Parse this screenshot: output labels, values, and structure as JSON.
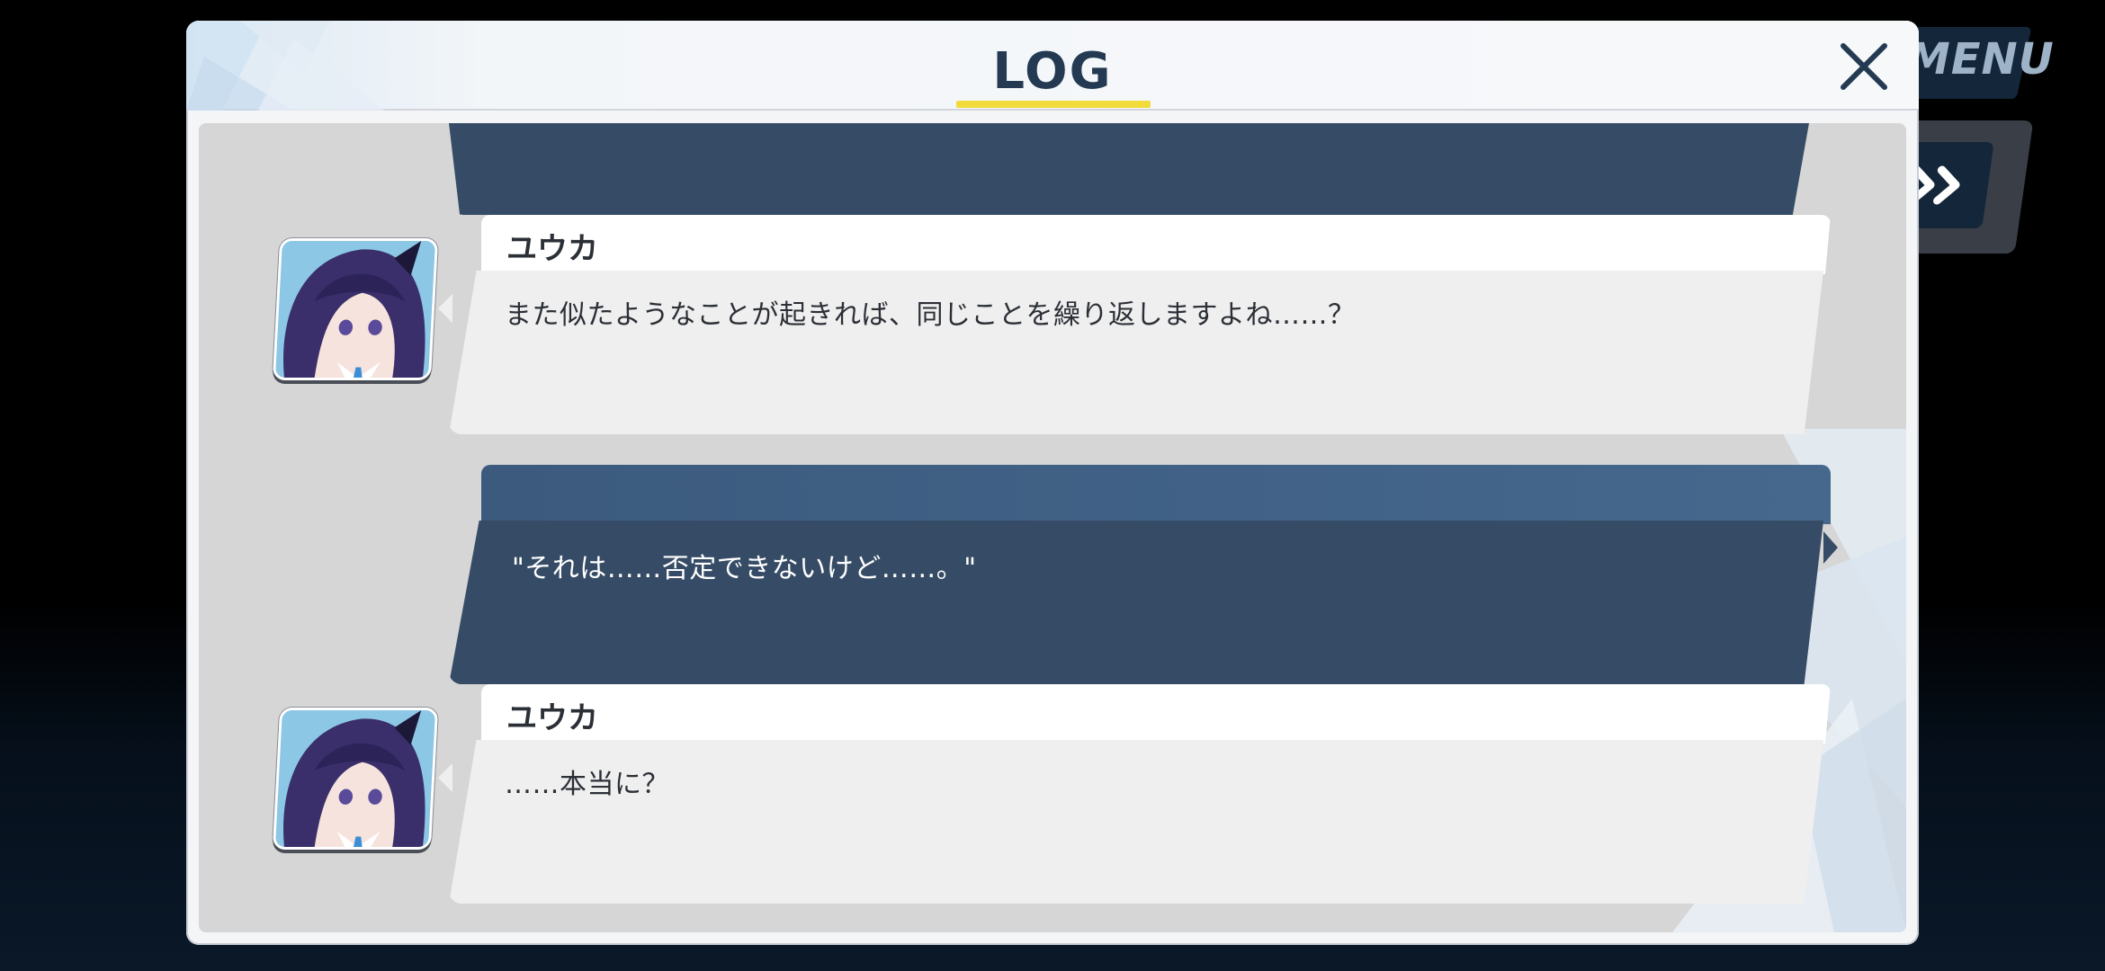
{
  "hud": {
    "menu_label": "MENU",
    "fast_forward_icon": "fast-forward-icon"
  },
  "log": {
    "title": "LOG",
    "close_icon": "close-icon",
    "accent_color": "#f1dc3c",
    "entries": [
      {
        "speaker": "ユウカ",
        "avatar": "yuuka-portrait",
        "text": "また似たようなことが起きれば、同じことを繰り返しますよね……？"
      },
      {
        "speaker": "",
        "type": "player",
        "text": "\"それは……否定できないけど……。\""
      },
      {
        "speaker": "ユウカ",
        "avatar": "yuuka-portrait",
        "text": "……本当に？"
      }
    ]
  }
}
